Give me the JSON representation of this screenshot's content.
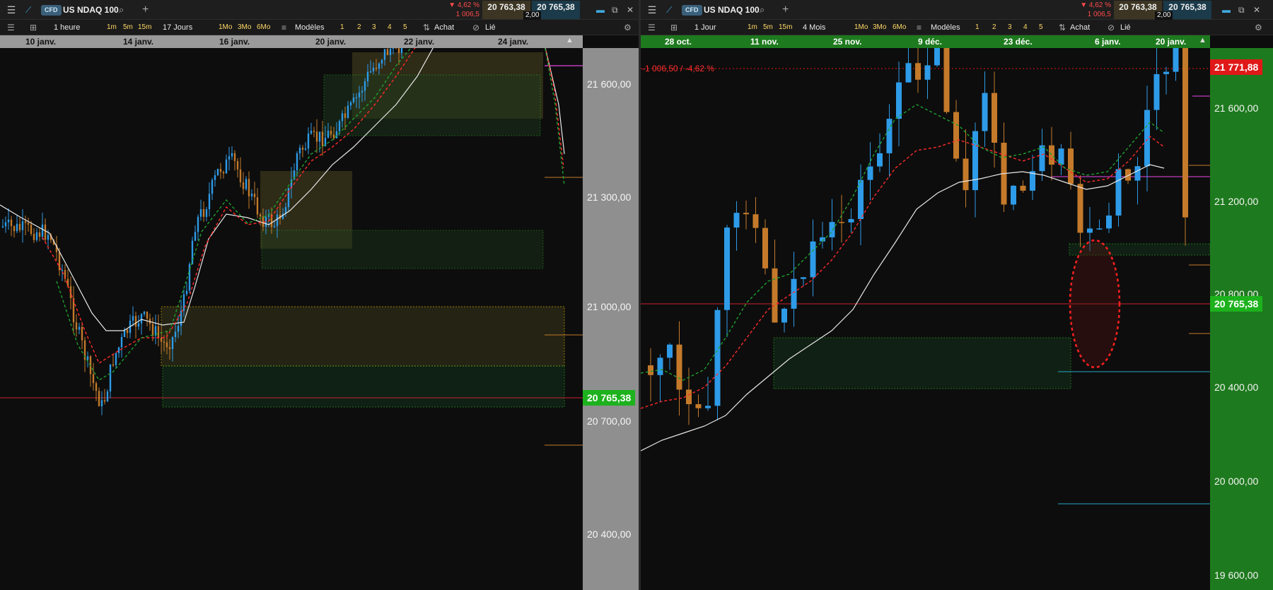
{
  "left": {
    "menu_icon": "menu-icon",
    "cfd": "CFD",
    "instrument": "US NDAQ 100",
    "change_pct": "▼ 4,62 %",
    "change_abs": "1 006,5",
    "bid": "20 763,38",
    "ask": "20 765,38",
    "spread": "2,00",
    "toolbar": {
      "interval": "1 heure",
      "quick_intervals": [
        "1m",
        "5m",
        "15m"
      ],
      "period": "17 Jours",
      "quick_periods": [
        "1Mo",
        "3Mo",
        "6Mo"
      ],
      "templates": "Modèles",
      "layouts": [
        "1",
        "2",
        "3",
        "4",
        "5"
      ],
      "buy": "Achat",
      "linked": "Lié"
    },
    "dates": [
      "10 janv.",
      "14 janv.",
      "16 janv.",
      "20 janv.",
      "22 janv.",
      "24 janv."
    ],
    "price_labels": [
      "21 600,00",
      "21 300,00",
      "21 000,00",
      "20 700,00",
      "20 400,00"
    ],
    "current_price": "20 765,38",
    "colors": {
      "axis_bg": "#8f8f8f",
      "current_tag": "#1db21d"
    }
  },
  "right": {
    "cfd": "CFD",
    "instrument": "US NDAQ 100",
    "change_pct": "▼ 4,62 %",
    "change_abs": "1 006,5",
    "bid": "20 763,38",
    "ask": "20 765,38",
    "spread": "2,00",
    "toolbar": {
      "interval": "1 Jour",
      "quick_intervals": [
        "1m",
        "5m",
        "15m"
      ],
      "period": "4 Mois",
      "quick_periods": [
        "1Mo",
        "3Mo",
        "6Mo"
      ],
      "templates": "Modèles",
      "layouts": [
        "1",
        "2",
        "3",
        "4",
        "5"
      ],
      "buy": "Achat",
      "linked": "Lié"
    },
    "dates": [
      "28 oct.",
      "11 nov.",
      "25 nov.",
      "9 déc.",
      "23 déc.",
      "6 janv.",
      "20 janv."
    ],
    "price_labels": [
      "21 600,00",
      "21 200,00",
      "20 800,00",
      "20 400,00",
      "20 000,00",
      "19 600,00"
    ],
    "change_annotation": "-1 006,50 / -4,62 %",
    "prev_close_tag": "21 771,88",
    "current_price": "20 765,38",
    "colors": {
      "axis_bg": "#1e7a1e",
      "current_tag": "#1db21d",
      "prev_close_tag": "#e01818"
    }
  }
}
